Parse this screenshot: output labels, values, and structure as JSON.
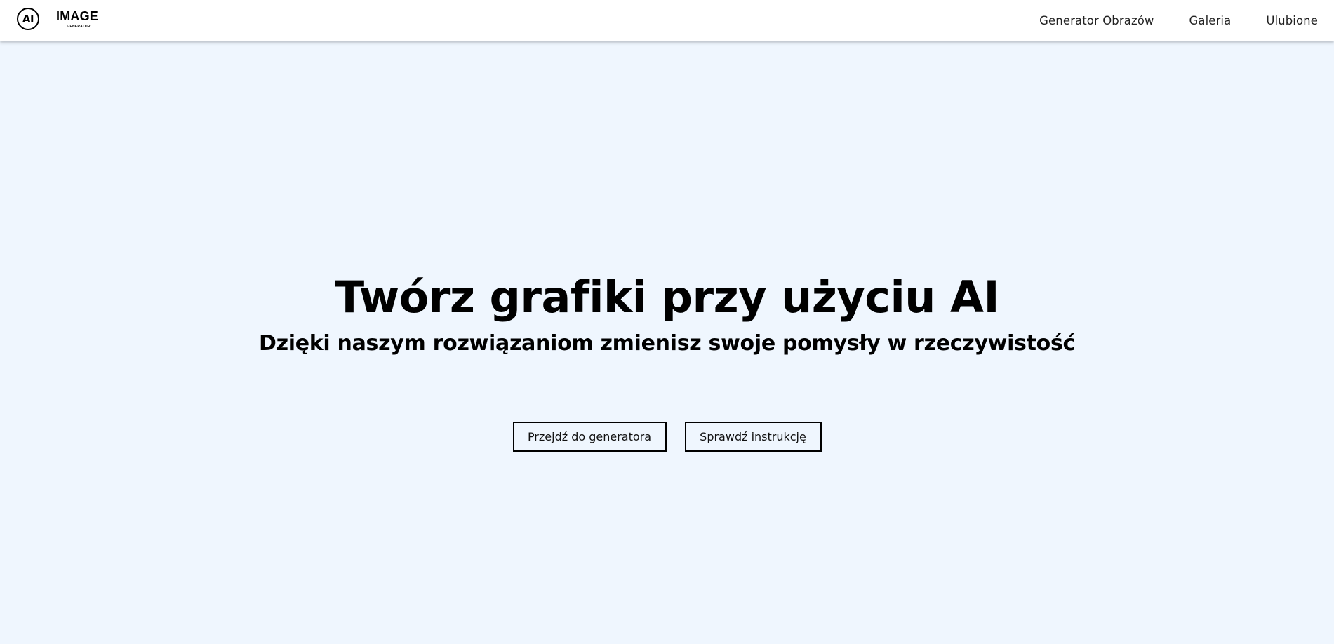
{
  "logo": {
    "mark": "AI",
    "word": "IMAGE",
    "sub": "GENERATOR"
  },
  "nav": {
    "items": [
      {
        "label": "Generator Obrazów"
      },
      {
        "label": "Galeria"
      },
      {
        "label": "Ulubione"
      }
    ]
  },
  "hero": {
    "title": "Twórz grafiki przy użyciu AI",
    "subtitle": "Dzięki naszym rozwiązaniom zmienisz swoje pomysły w rzeczywistość",
    "buttons": {
      "primary": "Przejdź do generatora",
      "secondary": "Sprawdź instrukcję"
    }
  },
  "colors": {
    "page_background": "#eff6fe",
    "navbar_background": "#ffffff",
    "text": "#000000"
  }
}
